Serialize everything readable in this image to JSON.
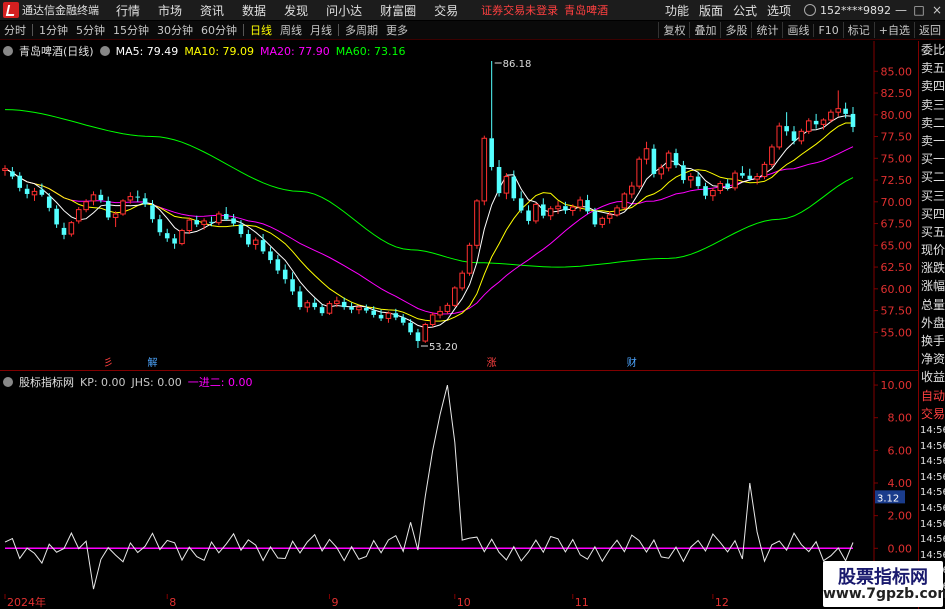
{
  "window": {
    "title": "通达信金融终端",
    "menu": [
      "行情",
      "市场",
      "资讯",
      "数据",
      "发现",
      "问小达",
      "财富圈",
      "交易"
    ],
    "notice": "证券交易未登录",
    "notice_stock": "青岛啤酒",
    "right_menu": [
      "功能",
      "版面",
      "公式",
      "选项"
    ],
    "user_id": "152****9892",
    "controls": [
      "—",
      "□",
      "×"
    ]
  },
  "toolbar": {
    "periods": [
      "分时",
      "1分钟",
      "5分钟",
      "15分钟",
      "30分钟",
      "60分钟",
      "日线",
      "周线",
      "月线",
      "多周期",
      "更多"
    ],
    "active_period": "日线",
    "tools": [
      "复权",
      "叠加",
      "多股",
      "统计",
      "画线",
      "F10",
      "标记",
      "+自选",
      "返回"
    ]
  },
  "main_chart": {
    "stock_label": "青岛啤酒(日线)",
    "ma_legend": [
      {
        "label": "MA5: 79.49",
        "color": "#ffffff"
      },
      {
        "label": "MA10: 79.09",
        "color": "#ffff00"
      },
      {
        "label": "MA20: 77.90",
        "color": "#ff00ff"
      },
      {
        "label": "MA60: 73.16",
        "color": "#00ff00"
      }
    ],
    "high_label": "86.18",
    "low_label": "53.20",
    "event_markers": [
      {
        "text": "彡",
        "color": "#ff4040",
        "day": 14
      },
      {
        "text": "解",
        "color": "#4da6ff",
        "day": 20
      },
      {
        "text": "涨",
        "color": "#ff4040",
        "day": 66
      },
      {
        "text": "财",
        "color": "#4da6ff",
        "day": 85
      }
    ]
  },
  "chart_data": {
    "type": "candlestick",
    "y_ticks": [
      "85.00",
      "82.50",
      "80.00",
      "77.50",
      "75.00",
      "72.50",
      "70.00",
      "67.50",
      "65.00",
      "62.50",
      "60.00",
      "57.50",
      "55.00"
    ],
    "ylim": [
      53.2,
      86.18
    ],
    "ohlc": [
      [
        73.6,
        74.2,
        73.0,
        73.8
      ],
      [
        73.5,
        74.0,
        72.6,
        72.9
      ],
      [
        73.0,
        73.4,
        71.2,
        71.6
      ],
      [
        71.5,
        72.0,
        70.4,
        70.9
      ],
      [
        70.8,
        71.6,
        70.1,
        71.2
      ],
      [
        71.4,
        72.1,
        70.6,
        70.8
      ],
      [
        70.6,
        71.0,
        68.9,
        69.3
      ],
      [
        69.2,
        69.6,
        67.0,
        67.4
      ],
      [
        67.0,
        67.6,
        65.7,
        66.2
      ],
      [
        66.3,
        67.8,
        66.0,
        67.6
      ],
      [
        67.8,
        69.4,
        67.5,
        69.1
      ],
      [
        69.1,
        70.3,
        68.8,
        70.0
      ],
      [
        70.1,
        71.2,
        69.6,
        70.8
      ],
      [
        70.8,
        71.4,
        69.9,
        70.2
      ],
      [
        70.1,
        70.6,
        67.9,
        68.2
      ],
      [
        68.2,
        68.9,
        67.1,
        68.6
      ],
      [
        68.6,
        70.3,
        68.4,
        70.1
      ],
      [
        70.2,
        71.1,
        69.8,
        70.6
      ],
      [
        70.6,
        71.3,
        70.0,
        70.5
      ],
      [
        70.4,
        71.0,
        69.4,
        69.7
      ],
      [
        69.6,
        70.2,
        67.6,
        68.0
      ],
      [
        68.0,
        68.5,
        66.1,
        66.5
      ],
      [
        66.4,
        66.9,
        65.4,
        65.8
      ],
      [
        65.8,
        66.3,
        64.6,
        65.2
      ],
      [
        65.2,
        66.9,
        65.0,
        66.7
      ],
      [
        66.7,
        68.2,
        66.3,
        67.9
      ],
      [
        67.9,
        68.4,
        67.1,
        67.4
      ],
      [
        67.4,
        68.1,
        66.8,
        67.8
      ],
      [
        67.7,
        68.3,
        67.2,
        67.6
      ],
      [
        67.6,
        68.9,
        67.3,
        68.6
      ],
      [
        68.6,
        69.4,
        67.8,
        68.0
      ],
      [
        68.1,
        68.6,
        67.2,
        67.5
      ],
      [
        67.4,
        67.9,
        65.9,
        66.3
      ],
      [
        66.3,
        66.8,
        64.8,
        65.1
      ],
      [
        65.1,
        65.9,
        64.5,
        65.6
      ],
      [
        65.6,
        66.3,
        64.0,
        64.3
      ],
      [
        64.3,
        64.8,
        62.9,
        63.3
      ],
      [
        63.4,
        63.9,
        61.7,
        62.1
      ],
      [
        62.2,
        62.8,
        60.6,
        61.1
      ],
      [
        61.1,
        61.9,
        59.3,
        59.7
      ],
      [
        59.7,
        60.3,
        57.6,
        57.9
      ],
      [
        57.9,
        58.7,
        57.3,
        58.4
      ],
      [
        58.4,
        58.9,
        57.6,
        57.9
      ],
      [
        57.9,
        58.2,
        56.9,
        57.2
      ],
      [
        57.2,
        58.6,
        57.0,
        58.3
      ],
      [
        58.3,
        59.1,
        57.9,
        58.6
      ],
      [
        58.5,
        59.0,
        57.6,
        57.9
      ],
      [
        57.9,
        58.4,
        57.2,
        57.6
      ],
      [
        57.6,
        58.1,
        57.1,
        57.9
      ],
      [
        57.8,
        58.2,
        57.2,
        57.5
      ],
      [
        57.5,
        58.0,
        56.7,
        57.0
      ],
      [
        57.0,
        57.6,
        56.3,
        56.6
      ],
      [
        56.6,
        57.4,
        56.1,
        57.2
      ],
      [
        57.2,
        57.7,
        56.4,
        56.7
      ],
      [
        56.7,
        57.1,
        55.8,
        56.1
      ],
      [
        56.1,
        56.5,
        54.7,
        55.0
      ],
      [
        55.0,
        55.4,
        53.2,
        54.0
      ],
      [
        54.0,
        56.1,
        53.8,
        55.9
      ],
      [
        55.9,
        57.3,
        55.6,
        57.0
      ],
      [
        57.0,
        58.0,
        56.6,
        57.4
      ],
      [
        57.4,
        58.4,
        57.1,
        58.1
      ],
      [
        58.1,
        60.3,
        57.9,
        60.1
      ],
      [
        60.1,
        62.1,
        59.8,
        61.8
      ],
      [
        61.8,
        65.3,
        61.5,
        65.0
      ],
      [
        65.0,
        70.3,
        64.6,
        70.1
      ],
      [
        70.1,
        77.6,
        69.6,
        77.3
      ],
      [
        77.3,
        86.18,
        73.6,
        74.0
      ],
      [
        74.0,
        74.8,
        70.6,
        71.0
      ],
      [
        71.0,
        73.3,
        70.3,
        72.9
      ],
      [
        72.9,
        73.6,
        70.1,
        70.4
      ],
      [
        70.4,
        71.2,
        68.7,
        69.0
      ],
      [
        69.0,
        69.6,
        67.4,
        67.8
      ],
      [
        67.8,
        69.9,
        67.5,
        69.7
      ],
      [
        69.7,
        70.4,
        68.1,
        68.4
      ],
      [
        68.4,
        69.5,
        67.9,
        69.2
      ],
      [
        69.2,
        70.1,
        68.6,
        69.5
      ],
      [
        69.5,
        70.0,
        68.6,
        69.0
      ],
      [
        69.0,
        69.7,
        68.4,
        69.4
      ],
      [
        69.4,
        70.6,
        68.9,
        70.2
      ],
      [
        70.2,
        70.8,
        68.6,
        68.9
      ],
      [
        68.9,
        69.3,
        67.1,
        67.4
      ],
      [
        67.4,
        68.3,
        67.0,
        68.1
      ],
      [
        68.1,
        68.9,
        67.5,
        68.5
      ],
      [
        68.5,
        69.6,
        68.3,
        69.3
      ],
      [
        69.3,
        71.1,
        69.1,
        70.9
      ],
      [
        70.9,
        72.3,
        70.4,
        71.8
      ],
      [
        71.8,
        75.2,
        71.5,
        74.9
      ],
      [
        74.9,
        76.9,
        74.3,
        76.1
      ],
      [
        76.1,
        76.6,
        72.8,
        73.2
      ],
      [
        73.2,
        74.3,
        72.6,
        73.9
      ],
      [
        73.9,
        75.9,
        73.5,
        75.6
      ],
      [
        75.6,
        76.1,
        73.9,
        74.2
      ],
      [
        74.2,
        74.7,
        72.1,
        72.5
      ],
      [
        72.5,
        73.3,
        71.6,
        72.9
      ],
      [
        72.9,
        73.4,
        71.5,
        71.8
      ],
      [
        71.8,
        72.2,
        70.3,
        70.7
      ],
      [
        70.7,
        71.6,
        70.1,
        71.3
      ],
      [
        71.3,
        72.4,
        70.9,
        72.1
      ],
      [
        72.1,
        72.6,
        71.3,
        71.6
      ],
      [
        71.6,
        73.6,
        71.3,
        73.3
      ],
      [
        73.3,
        74.1,
        72.7,
        73.0
      ],
      [
        73.0,
        73.8,
        72.4,
        72.6
      ],
      [
        72.6,
        73.3,
        72.0,
        72.9
      ],
      [
        72.9,
        74.6,
        72.6,
        74.3
      ],
      [
        74.3,
        76.6,
        74.0,
        76.3
      ],
      [
        76.3,
        79.1,
        76.0,
        78.7
      ],
      [
        78.7,
        80.3,
        77.6,
        78.1
      ],
      [
        78.1,
        78.7,
        76.6,
        77.0
      ],
      [
        77.0,
        78.4,
        76.6,
        78.1
      ],
      [
        78.1,
        79.6,
        77.8,
        79.3
      ],
      [
        79.3,
        80.1,
        78.4,
        78.9
      ],
      [
        78.9,
        79.6,
        78.3,
        79.4
      ],
      [
        79.4,
        80.6,
        79.1,
        80.3
      ],
      [
        80.3,
        82.8,
        79.8,
        80.7
      ],
      [
        80.7,
        81.4,
        79.6,
        80.1
      ],
      [
        80.1,
        80.9,
        78.0,
        78.6
      ]
    ],
    "ma60_anchors": [
      [
        0,
        80.6
      ],
      [
        20,
        77.5
      ],
      [
        40,
        71.2
      ],
      [
        55,
        64.5
      ],
      [
        64,
        63.0
      ],
      [
        75,
        62.5
      ],
      [
        90,
        63.5
      ],
      [
        105,
        68.0
      ],
      [
        117,
        73.16
      ]
    ],
    "indicator": {
      "title": "股标指标网",
      "legend": [
        {
          "label": "KP: 0.00",
          "color": "#c8c8c8"
        },
        {
          "label": "JHS: 0.00",
          "color": "#c8c8c8"
        },
        {
          "label": "一进二: 0.00",
          "color": "#ff00ff"
        }
      ],
      "y_ticks": [
        "10.00",
        "8.00",
        "6.00",
        "4.00",
        "2.00",
        "0.00"
      ],
      "ylim": [
        -2.8,
        10.8
      ],
      "current_value": "3.12",
      "spikes": [
        [
          12,
          -2.5
        ],
        [
          55,
          1.6
        ],
        [
          57,
          3.2
        ],
        [
          58,
          6.0
        ],
        [
          59,
          8.2
        ],
        [
          60,
          10.0
        ],
        [
          61,
          6.5
        ],
        [
          62,
          0.5
        ],
        [
          101,
          4.0
        ],
        [
          102,
          1.0
        ]
      ]
    },
    "time_axis": [
      {
        "label": "2024年",
        "day": 0
      },
      {
        "label": "8",
        "day": 22
      },
      {
        "label": "9",
        "day": 44
      },
      {
        "label": "10",
        "day": 61
      },
      {
        "label": "11",
        "day": 77
      },
      {
        "label": "12",
        "day": 96
      }
    ]
  },
  "side_panel": {
    "items": [
      "委比",
      "卖五",
      "卖四",
      "卖三",
      "卖二",
      "卖一",
      "买一",
      "买二",
      "买三",
      "买四",
      "买五",
      "现价",
      "涨跌",
      "涨幅",
      "总量",
      "外盘",
      "换手",
      "净资",
      "收益",
      "自动",
      "交易"
    ],
    "times": [
      "14:56",
      "14:56",
      "14:56",
      "14:56",
      "14:56",
      "14:56",
      "14:56",
      "14:56",
      "14:56",
      "14:56",
      "14:56"
    ]
  },
  "watermark": {
    "title": "股票指标网",
    "url": "www.7gpzb.com"
  },
  "colors": {
    "up": "#ff3030",
    "down": "#54ffff",
    "ma5": "#ffffff",
    "ma10": "#ffff00",
    "ma20": "#ff00ff",
    "ma60": "#00ff00",
    "grid": "#600000",
    "axis_text": "#e03030"
  }
}
